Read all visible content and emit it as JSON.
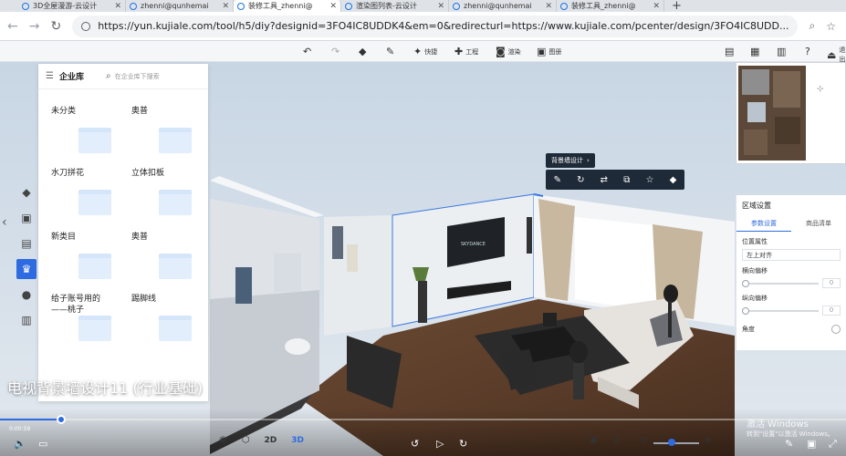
{
  "browser": {
    "tabs": [
      {
        "title": "3D全屋漫游-云设计",
        "active": false
      },
      {
        "title": "zhenni@qunhemai",
        "active": false
      },
      {
        "title": "装修工具_zhenni@",
        "active": true
      },
      {
        "title": "渲染图列表-云设计",
        "active": false
      },
      {
        "title": "zhenni@qunhemai",
        "active": false
      },
      {
        "title": "装修工具_zhenni@",
        "active": false
      }
    ],
    "new_tab": "+",
    "url": "https://yun.kujiale.com/tool/h5/diy?designid=3FO4IC8UDDK4&em=0&redirecturl=https://www.kujiale.com/pcenter/design/3FO4IC8UDD..."
  },
  "toolbar": {
    "items": [
      {
        "icon": "undo-icon",
        "label": ""
      },
      {
        "icon": "redo-icon",
        "label": ""
      },
      {
        "icon": "eraser-icon",
        "label": ""
      },
      {
        "icon": "wrench-icon",
        "label": ""
      },
      {
        "icon": "shortcut-icon",
        "label": "快捷"
      },
      {
        "icon": "project-icon",
        "label": "工程"
      },
      {
        "icon": "render-icon",
        "label": "渲染"
      },
      {
        "icon": "drawing-icon",
        "label": "图册"
      }
    ],
    "right_exit": "退出"
  },
  "library": {
    "title": "企业库",
    "search_placeholder": "在企业库下搜索",
    "categories": [
      {
        "label": "未分类"
      },
      {
        "label": "奥普"
      },
      {
        "label": "水刀拼花"
      },
      {
        "label": "立体扣板"
      },
      {
        "label": "新类目"
      },
      {
        "label": "奥普"
      },
      {
        "label": "给子账号用的——桃子"
      },
      {
        "label": "踢脚线"
      }
    ]
  },
  "context": {
    "label": "背景墙设计",
    "arrow": "›"
  },
  "region_panel": {
    "title": "区域设置",
    "tabs": [
      "参数设置",
      "商品清单"
    ],
    "section": "位置属性",
    "align_value": "左上对齐",
    "h_offset_label": "横向偏移",
    "h_offset_value": "0",
    "v_offset_label": "纵向偏移",
    "v_offset_value": "0",
    "angle_label": "角度",
    "unit": "m"
  },
  "video": {
    "caption": "电视背景墙设计11 (行业基础)",
    "time": "0:00:59",
    "progress_fraction": 0.072
  },
  "view": {
    "mode_2d": "2D",
    "mode_3d": "3D"
  },
  "watermark": {
    "line1": "激活 Windows",
    "line2": "转到\"设置\"以激活 Windows。"
  }
}
